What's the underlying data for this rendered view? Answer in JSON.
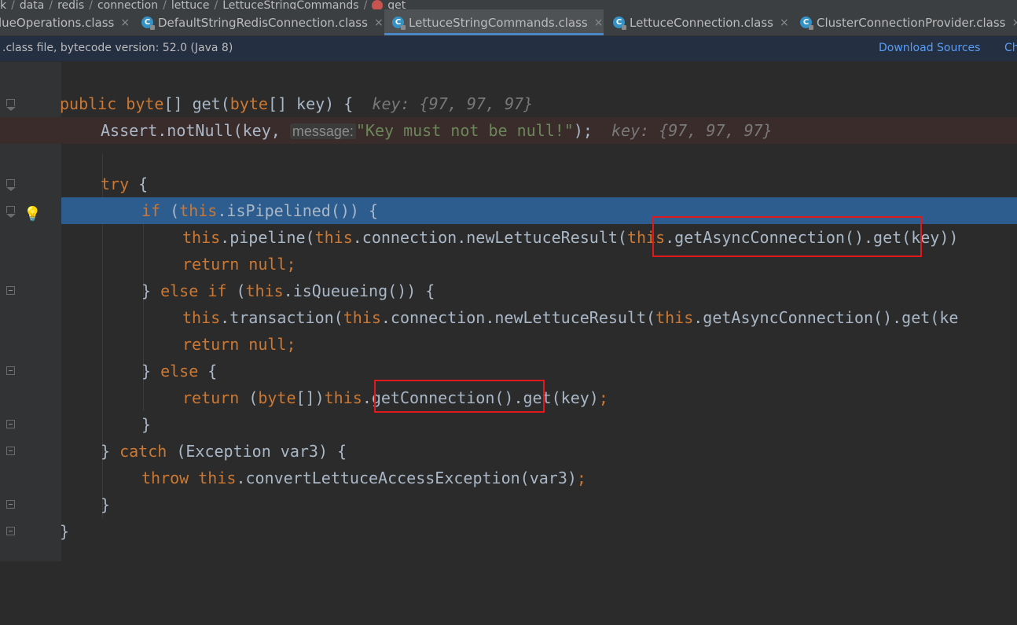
{
  "breadcrumb": [
    "k",
    "data",
    "redis",
    "connection",
    "lettuce",
    "LettuceStringCommands",
    "get"
  ],
  "tabs": [
    {
      "label": "lueOperations.class",
      "active": false
    },
    {
      "label": "DefaultStringRedisConnection.class",
      "active": false
    },
    {
      "label": "LettuceStringCommands.class",
      "active": true
    },
    {
      "label": "LettuceConnection.class",
      "active": false
    },
    {
      "label": "ClusterConnectionProvider.class",
      "active": false
    }
  ],
  "infobar": {
    "message": ".class file, bytecode version: 52.0 (Java 8)",
    "download_sources": "Download Sources",
    "choose_sources": "Ch"
  },
  "code": {
    "l1_a": "public",
    "l1_b": " ",
    "l1_c": "byte",
    "l1_d": "[] get(",
    "l1_e": "byte",
    "l1_f": "[] key) {",
    "l1_hint": "key: {97, 97, 97}",
    "l2_a": "Assert.notNull(key, ",
    "l2_param": "message:",
    "l2_str": "\"Key must not be null!\"",
    "l2_b": ");",
    "l2_hint": "key: {97, 97, 97}",
    "l4_try": "try",
    "l4_rest": " {",
    "l5_if": "if",
    "l5_a": " (",
    "l5_this": "this",
    "l5_b": ".isPipelined()) {",
    "l6_this1": "this",
    "l6_a": ".pipeline(",
    "l6_this2": "this",
    "l6_b": ".connection.newLettuceResult(",
    "l6_this3": "this",
    "l6_c": ".getAsyncConnection().get(key))",
    "l7_return": "return",
    "l7_null": " null",
    "l7_semi": ";",
    "l8_a": "} ",
    "l8_else": "else",
    "l8_sp": " ",
    "l8_if": "if",
    "l8_b": " (",
    "l8_this": "this",
    "l8_c": ".isQueueing()) {",
    "l9_this1": "this",
    "l9_a": ".transaction(",
    "l9_this2": "this",
    "l9_b": ".connection.newLettuceResult(",
    "l9_this3": "this",
    "l9_c": ".getAsyncConnection().get(ke",
    "l10_return": "return",
    "l10_null": " null",
    "l10_semi": ";",
    "l11_a": "} ",
    "l11_else": "else",
    "l11_b": " {",
    "l12_return": "return",
    "l12_a": " (",
    "l12_byte": "byte",
    "l12_b": "[])",
    "l12_this": "this",
    "l12_c": ".getConnection().get(key)",
    "l12_semi": ";",
    "l13": "}",
    "l14_a": "} ",
    "l14_catch": "catch",
    "l14_b": " (Exception var3) {",
    "l15_throw": "throw",
    "l15_sp": " ",
    "l15_this": "this",
    "l15_a": ".convertLettuceAccessException(var3)",
    "l15_semi": ";",
    "l16": "}",
    "l17": "}"
  },
  "colors": {
    "background": "#2b2b2b",
    "keyword": "#cc7832",
    "string": "#6a8759",
    "current_line": "#2d5c8f",
    "highlight_box": "#e0191e",
    "link": "#589df6"
  }
}
